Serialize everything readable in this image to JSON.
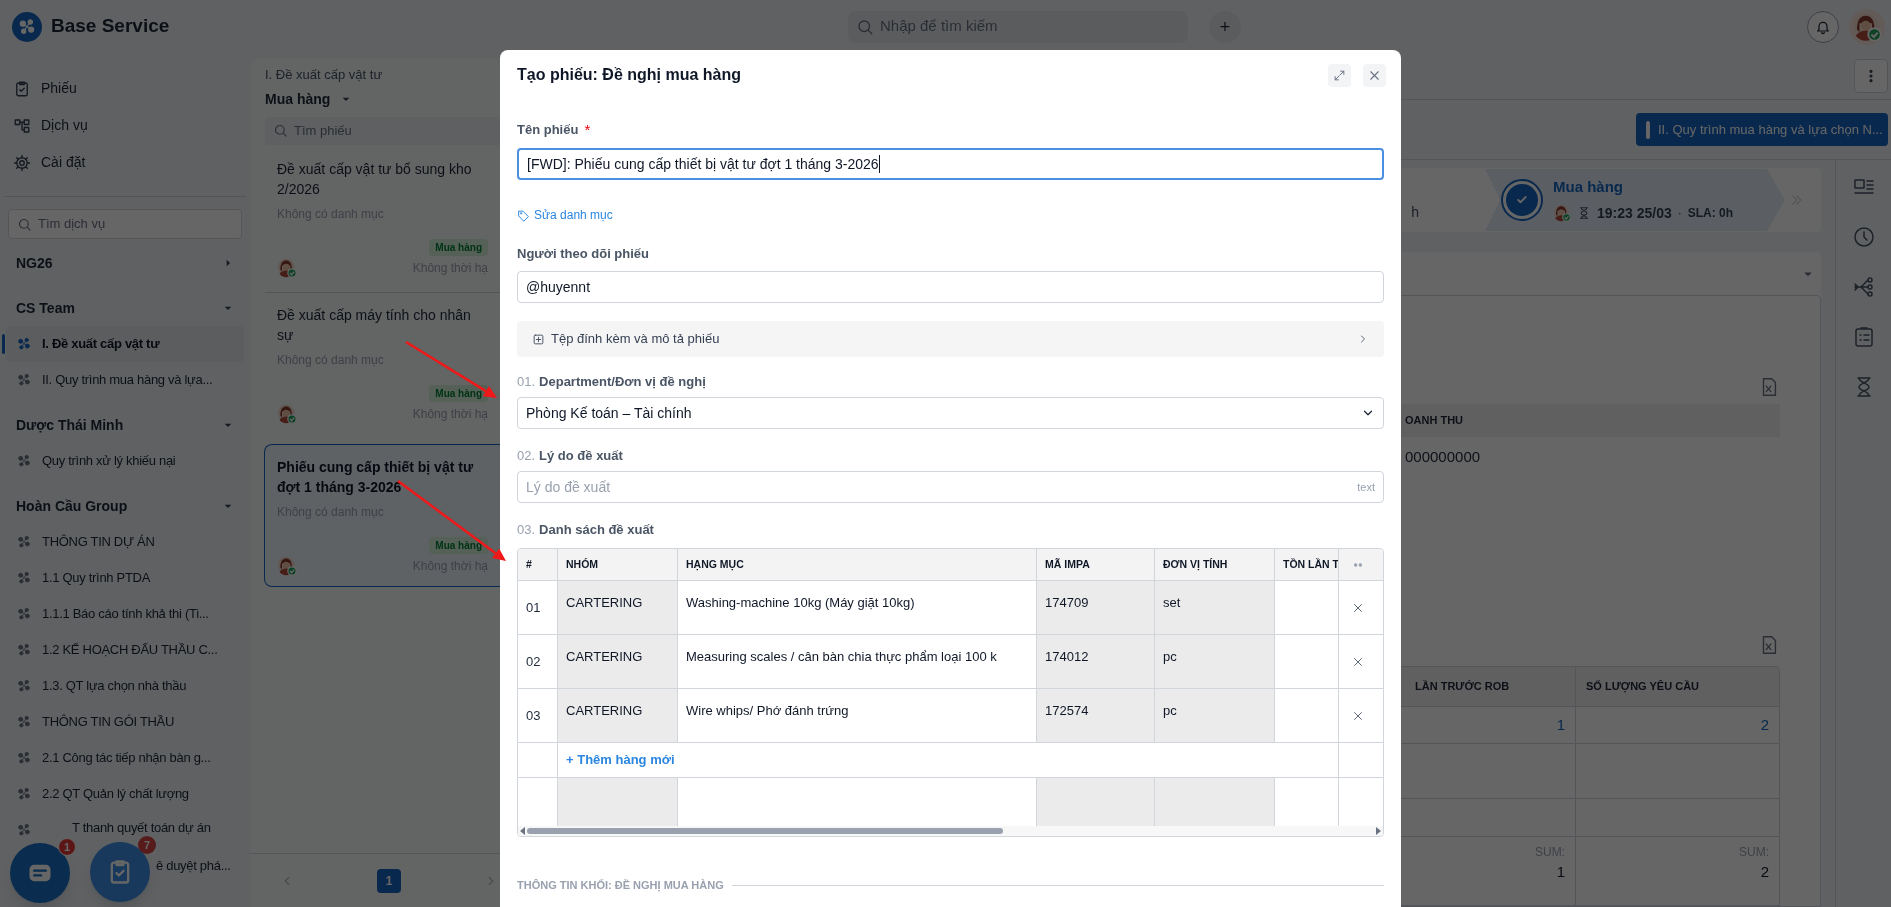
{
  "app": {
    "name": "Base Service"
  },
  "topbar": {
    "search_placeholder": "Nhập để tìm kiếm",
    "add_button": "+"
  },
  "sidebar": {
    "nav": [
      {
        "label": "Phiếu",
        "kind": "tickets"
      },
      {
        "label": "Dịch vụ",
        "kind": "services"
      },
      {
        "label": "Cài đặt",
        "kind": "settings"
      }
    ],
    "search_placeholder": "Tìm dịch vụ",
    "groups": [
      {
        "name": "NG26",
        "expanded": false
      },
      {
        "name": "CS Team",
        "expanded": true,
        "items": [
          {
            "label": "I. Đề xuất cấp vật tư",
            "selected": true
          },
          {
            "label": "II. Quy trình mua hàng và lựa...",
            "selected": false
          }
        ]
      },
      {
        "name": "Dược Thái Minh",
        "expanded": true,
        "items": [
          {
            "label": "Quy trình xử lý khiếu nại",
            "selected": false
          }
        ]
      },
      {
        "name": "Hoàn Cầu Group",
        "expanded": true,
        "items": [
          {
            "label": "THÔNG TIN DỰ ÁN",
            "selected": false
          },
          {
            "label": "1.1 Quy trình PTDA",
            "selected": false
          },
          {
            "label": "1.1.1 Báo cáo tính khả thi (Ti...",
            "selected": false
          },
          {
            "label": "1.2 KẾ HOẠCH ĐẤU THẦU C...",
            "selected": false
          },
          {
            "label": "1.3. QT lựa chọn nhà thầu",
            "selected": false
          },
          {
            "label": "THÔNG TIN GÓI THẦU",
            "selected": false
          },
          {
            "label": "2.1 Công tác tiếp nhận bàn g...",
            "selected": false
          },
          {
            "label": "2.2 QT Quản lý chất lượng",
            "selected": false
          },
          {
            "label": "T thanh quyết toán dự án",
            "selected": false
          },
          {
            "label": "ê duyệt phá...",
            "selected": false
          }
        ]
      }
    ]
  },
  "floating_buttons": [
    {
      "kind": "chat",
      "badge": "1"
    },
    {
      "kind": "tasks",
      "badge": "7"
    }
  ],
  "ticket_list": {
    "breadcrumb": "I. Đề xuất cấp vật tư",
    "filter": "Mua hàng",
    "search_placeholder": "Tìm phiếu",
    "tickets": [
      {
        "title": "Đề xuất cấp vật tư bổ sung kho 2/2026",
        "category": "Không có danh mục",
        "stage": "Mua hàng",
        "due": "Không thời hạ",
        "selected": false
      },
      {
        "title": "Đề xuất cấp máy tính cho nhân sự",
        "category": "Không có danh mục",
        "stage": "Mua hàng",
        "due": "Không thời hạ",
        "selected": false
      },
      {
        "title": "Phiếu cung cấp thiết bị vật tư đợt 1 tháng 3-2026",
        "category": "Không có danh mục",
        "stage": "Mua hàng",
        "due": "Không thời hạ",
        "selected": true
      }
    ],
    "pages": [
      {
        "label": "1",
        "selected": true
      }
    ]
  },
  "detail": {
    "process_button": "II. Quy trình mua hàng và lựa chọn N...",
    "stage": {
      "previous_fragment": "h",
      "name": "Mua hàng",
      "time": "19:23 25/03",
      "separator": "·",
      "sla": "SLA: 0h"
    },
    "table_1": {
      "header": "OANH THU",
      "value": "000000000"
    },
    "table_2": {
      "columns": [
        "LẦN TRƯỚC ROB",
        "SỐ LƯỢNG YÊU CẦU"
      ],
      "rows": [
        [
          "1",
          "2"
        ]
      ],
      "sum_labels": [
        "SUM:",
        "SUM:"
      ],
      "sums": [
        "1",
        "2"
      ]
    }
  },
  "modal": {
    "title": "Tạo phiếu: Đề nghị mua hàng",
    "name_field": {
      "label": "Tên phiếu",
      "required_mark": "*",
      "value": "[FWD]: Phiếu cung cấp thiết bị vật tư đợt 1 tháng 3-2026",
      "focused": true
    },
    "category_link": "Sửa danh mục",
    "watchers_field": {
      "label": "Người theo dõi phiếu",
      "value": "@huyennt"
    },
    "attachments": {
      "label": "Tệp đính kèm và mô tả phiếu",
      "expanded": false
    },
    "form_fields": [
      {
        "kind": "select",
        "number": "01.",
        "label": "Department/Đơn vị đề nghị",
        "value": "Phòng Kế toán – Tài chính"
      },
      {
        "kind": "text",
        "number": "02.",
        "label": "Lý do đề xuất",
        "placeholder": "Lý do đề xuất",
        "type_hint": "text"
      },
      {
        "kind": "table",
        "number": "03.",
        "label": "Danh sách đề xuất",
        "columns": [
          {
            "label": "#",
            "readonly": false
          },
          {
            "label": "NHÓM",
            "readonly": true
          },
          {
            "label": "HẠNG MỤC",
            "readonly": false
          },
          {
            "label": "MÃ IMPA",
            "readonly": true
          },
          {
            "label": "ĐƠN VỊ TÍNH",
            "readonly": true
          },
          {
            "label": "TỒN LẦN T",
            "readonly": false
          }
        ],
        "rows": [
          {
            "cells": [
              "01",
              "CARTERING",
              "Washing-machine 10kg (Máy giặt 10kg)",
              "174709",
              "set"
            ]
          },
          {
            "cells": [
              "02",
              "CARTERING",
              "Measuring scales / cân bàn chia thực phẩm loại 100 k",
              "174012",
              "pc"
            ]
          },
          {
            "cells": [
              "03",
              "CARTERING",
              "Wire whips/ Phớ đánh trứng",
              "172574",
              "pc"
            ]
          }
        ],
        "add_row": "+ Thêm hàng mới"
      }
    ],
    "section_title": "THÔNG TIN KHỐI: ĐỀ NGHỊ MUA HÀNG"
  }
}
